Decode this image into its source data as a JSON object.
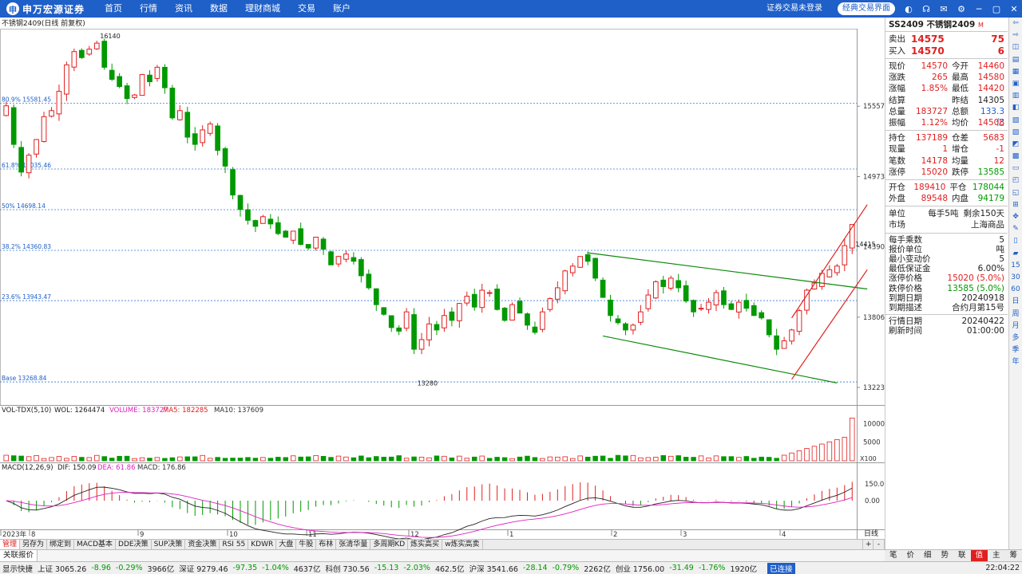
{
  "topbar": {
    "logo_text": "申万宏源证券",
    "nav": [
      "首页",
      "行情",
      "资讯",
      "数据",
      "理财商城",
      "交易",
      "账户"
    ],
    "login_status": "证券交易未登录",
    "classic_button": "经典交易界面"
  },
  "chart_header": {
    "title": "不锈钢2409(日线 前复权)"
  },
  "chart_data": {
    "type": "candlestick",
    "title": "不锈钢2409(日线 前复权)",
    "price_ticks": [
      "15557",
      "14973",
      "14390",
      "13806",
      "13223"
    ],
    "price_range": [
      13150,
      16200
    ],
    "fibonacci": [
      {
        "label": "80.9% 15581.45",
        "value": 15581.45
      },
      {
        "label": "61.8% 15035.46",
        "value": 15035.46
      },
      {
        "label": "50% 14698.14",
        "value": 14698.14
      },
      {
        "label": "38.2% 14360.83",
        "value": 14360.83
      },
      {
        "label": "23.6% 13943.47",
        "value": 13943.47
      },
      {
        "label": "Base 13268.84",
        "value": 13268.84
      }
    ],
    "annotations": [
      {
        "label": "16140",
        "value": 16140
      },
      {
        "label": "13280",
        "value": 13280
      },
      {
        "label": "14415",
        "value": 14415
      }
    ],
    "series": [
      {
        "name": "close",
        "values": [
          15560,
          15240,
          15010,
          15150,
          15280,
          15470,
          15520,
          15680,
          15900,
          16010,
          15960,
          16030,
          16080,
          15880,
          15780,
          15720,
          15620,
          15650,
          15820,
          15760,
          15880,
          15710,
          15460,
          15520,
          15300,
          15240,
          15360,
          15410,
          15190,
          15060,
          14820,
          14700,
          14610,
          14560,
          14640,
          14580,
          14500,
          14470,
          14520,
          14410,
          14380,
          14470,
          14370,
          14240,
          14310,
          14330,
          14270,
          14150,
          14050,
          13910,
          13830,
          13720,
          13690,
          13850,
          13540,
          13620,
          13750,
          13700,
          13820,
          13780,
          13920,
          13980,
          13890,
          14030,
          14010,
          13870,
          13780,
          13910,
          13840,
          13740,
          13680,
          13850,
          13960,
          14050,
          14190,
          14230,
          14310,
          14270,
          14130,
          13970,
          13820,
          13760,
          13700,
          13740,
          13850,
          13990,
          14100,
          14060,
          14130,
          14050,
          13940,
          13850,
          13880,
          13930,
          14010,
          13910,
          13870,
          13930,
          13880,
          13820,
          13800,
          13660,
          13540,
          13610,
          13700,
          13860,
          14030,
          14090,
          14170,
          14200,
          14230,
          14400,
          14575
        ]
      }
    ],
    "volume_ticks": [
      "10000",
      "5000"
    ],
    "volume_unit": "X100",
    "macd_ticks": [
      "150.0",
      "0.00"
    ],
    "date_labels": [
      "2023年",
      "8",
      "9",
      "10",
      "11",
      "12",
      "1",
      "2",
      "3",
      "4"
    ],
    "period_label": "日线"
  },
  "volume_header": {
    "name": "VOL-TDX(5,10)",
    "wvol": "WOL: 1264474",
    "volume": "VOLUME: 183727",
    "ma5": "MA5: 182285",
    "ma10": "MA10: 137609"
  },
  "macd_header": {
    "name": "MACD(12,26,9)",
    "dif": "DIF: 150.09",
    "dea": "DEA: 61.86",
    "macd": "MACD: 176.86"
  },
  "quote": {
    "code": "SS2409",
    "name": "不锈钢2409",
    "tag": "M",
    "orderbook": [
      {
        "label": "卖出",
        "price": "14575",
        "vol": "75"
      },
      {
        "label": "买入",
        "price": "14570",
        "vol": "6"
      }
    ],
    "stats1": [
      [
        "现价",
        "14570",
        "今开",
        "14460"
      ],
      [
        "涨跌",
        "265",
        "最高",
        "14580"
      ],
      [
        "涨幅",
        "1.85%",
        "最低",
        "14420"
      ],
      [
        "结算",
        "",
        "昨结",
        "14305"
      ],
      [
        "总量",
        "183727",
        "总额",
        "133.3亿"
      ],
      [
        "振幅",
        "1.12%",
        "均价",
        "14508"
      ]
    ],
    "stats2": [
      [
        "持仓",
        "137189",
        "仓差",
        "5683"
      ],
      [
        "现量",
        "1",
        "增仓",
        "-1"
      ],
      [
        "笔数",
        "14178",
        "均量",
        "12"
      ],
      [
        "涨停",
        "15020",
        "跌停",
        "13585"
      ]
    ],
    "stats3": [
      [
        "开仓",
        "189410",
        "平仓",
        "178044"
      ],
      [
        "外盘",
        "89548",
        "内盘",
        "94179"
      ]
    ],
    "unit_row": [
      "单位",
      "每手5吨",
      "剩余150天"
    ],
    "market_row": [
      "市场",
      "上海商品"
    ],
    "contract": [
      [
        "每手乘数",
        "5"
      ],
      [
        "报价单位",
        "吨"
      ],
      [
        "最小变动价",
        "5"
      ],
      [
        "最低保证金",
        "6.00%"
      ],
      [
        "涨停价格",
        "15020 (5.0%)"
      ],
      [
        "跌停价格",
        "13585 (5.0%)"
      ],
      [
        "到期日期",
        "20240918"
      ],
      [
        "到期描述",
        "合约月第15号"
      ]
    ],
    "dates": [
      [
        "行情日期",
        "20240422"
      ],
      [
        "刷新时间",
        "01:00:00"
      ]
    ]
  },
  "right_strip": [
    "⇦",
    "⇨",
    "◫",
    "▤",
    "▦",
    "▣",
    "▥",
    "◧",
    "▧",
    "▨",
    "◩",
    "▩",
    "▭",
    "◰",
    "◱",
    "⊞",
    "✥",
    "✎",
    "▯",
    "▰",
    "15",
    "30",
    "60",
    "日",
    "周",
    "月",
    "多",
    "季",
    "年"
  ],
  "tabs": [
    "管理",
    "另存为",
    "绑定到",
    "MACD基本",
    "DDE决策",
    "SUP决策",
    "资金决策",
    "RSI 55",
    "KDWR",
    "大盘",
    "牛股",
    "布林",
    "张清华量",
    "多周期KD",
    "炼实高买",
    "w炼实高卖"
  ],
  "rowbar": [
    "关联报价"
  ],
  "sub_right": [
    "笔",
    "价",
    "细",
    "势",
    "联",
    "值",
    "主",
    "筹"
  ],
  "statusbar": [
    {
      "t": "显示快捷"
    },
    {
      "t": "上证 3065.26"
    },
    {
      "t": "-8.96"
    },
    {
      "t": "-0.29%"
    },
    {
      "t": "3966亿"
    },
    {
      "t": "深证 9279.46"
    },
    {
      "t": "-97.35"
    },
    {
      "t": "-1.04%"
    },
    {
      "t": "4637亿"
    },
    {
      "t": "科创 730.56"
    },
    {
      "t": "-15.13"
    },
    {
      "t": "-2.03%"
    },
    {
      "t": "462.5亿"
    },
    {
      "t": "沪深 3541.66"
    },
    {
      "t": "-28.14"
    },
    {
      "t": "-0.79%"
    },
    {
      "t": "2262亿"
    },
    {
      "t": "创业 1756.00"
    },
    {
      "t": "-31.49"
    },
    {
      "t": "-1.76%"
    },
    {
      "t": "1920亿"
    }
  ],
  "status_conn": "已连接",
  "status_time": "22:04:22"
}
